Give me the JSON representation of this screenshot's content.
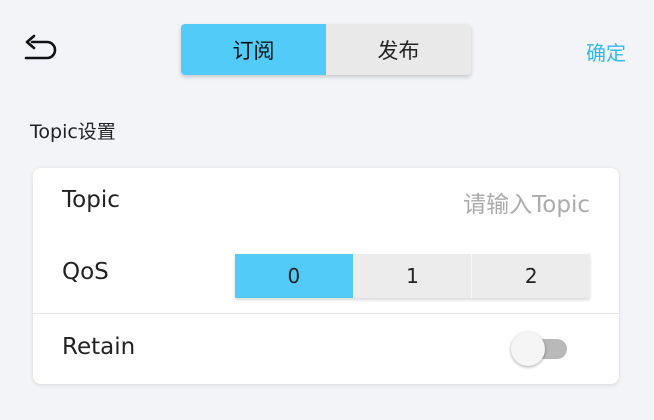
{
  "header": {
    "back_icon": "back-arrow-icon",
    "tabs": [
      {
        "label": "订阅",
        "active": true
      },
      {
        "label": "发布",
        "active": false
      }
    ],
    "confirm_label": "确定"
  },
  "section": {
    "title": "Topic设置"
  },
  "form": {
    "topic": {
      "label": "Topic",
      "value": "",
      "placeholder": "请输入Topic"
    },
    "qos": {
      "label": "QoS",
      "options": [
        "0",
        "1",
        "2"
      ],
      "selected": "0"
    },
    "retain": {
      "label": "Retain",
      "on": false
    }
  },
  "colors": {
    "accent": "#52cbf8",
    "link": "#37b8ec",
    "background": "#f3f4f8"
  }
}
